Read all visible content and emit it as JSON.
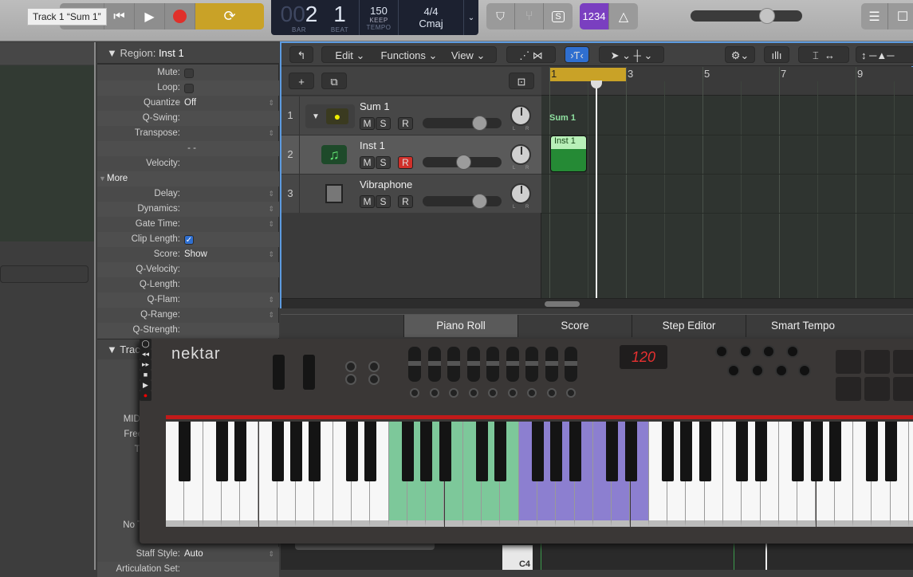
{
  "tooltip": "Track 1 “Sum 1”",
  "transport": {
    "buttons": [
      "forward-icon",
      "go-to-start-icon",
      "play-icon",
      "record-icon",
      "cycle-icon"
    ],
    "cycle_color": "#c9a227",
    "record_color": "#e0302a"
  },
  "lcd": {
    "bar_prefix": "00",
    "bar": "2",
    "beat": "1",
    "bar_label": "BAR",
    "beat_label": "BEAT",
    "tempo": "150",
    "tempo_mode": "KEEP",
    "tempo_label": "TEMPO",
    "signature": "4/4",
    "key": "Cmaj"
  },
  "toolbar_right": {
    "count_in": "1234",
    "count_in_color": "#7a3fc0",
    "master_volume": 0.68
  },
  "inspector": {
    "region_header": "Region:",
    "region_name": "Inst 1",
    "rows": [
      {
        "label": "Mute:",
        "type": "check",
        "checked": false
      },
      {
        "label": "Loop:",
        "type": "check",
        "checked": false
      },
      {
        "label": "Quantize",
        "value": "Off",
        "stepper": true
      },
      {
        "label": "Q-Swing:"
      },
      {
        "label": "Transpose:",
        "stepper": true
      },
      {
        "label": "- -"
      },
      {
        "label": "Velocity:"
      },
      {
        "label": "More",
        "section": true
      },
      {
        "label": "Delay:",
        "stepper": true
      },
      {
        "label": "Dynamics:",
        "stepper": true
      },
      {
        "label": "Gate Time:",
        "stepper": true
      },
      {
        "label": "Clip Length:",
        "type": "check",
        "checked": true
      },
      {
        "label": "Score:",
        "value": "Show",
        "stepper": true
      },
      {
        "label": "Q-Velocity:"
      },
      {
        "label": "Q-Length:"
      },
      {
        "label": "Q-Flam:",
        "stepper": true
      },
      {
        "label": "Q-Range:",
        "stepper": true
      },
      {
        "label": "Q-Strength:"
      }
    ],
    "track_header": "Track",
    "track_fragments": [
      "MIDI",
      "Free",
      "Tr",
      "No T"
    ],
    "staff_style_label": "Staff Style:",
    "staff_style_value": "Auto",
    "articulation_label": "Articulation Set:"
  },
  "tracks_toolbar": {
    "edit": "Edit",
    "functions": "Functions",
    "view": "View"
  },
  "tracks": [
    {
      "num": "1",
      "name": "Sum 1",
      "icon": "summing-stack-icon",
      "record_armed": false,
      "volume": 0.72,
      "pan": 0
    },
    {
      "num": "2",
      "name": "Inst 1",
      "icon": "music-note-icon",
      "record_armed": true,
      "volume": 0.52,
      "pan": 0,
      "selected": true
    },
    {
      "num": "3",
      "name": "Vibraphone",
      "icon": "vibraphone-icon",
      "record_armed": false,
      "volume": 0.72,
      "pan": 0
    }
  ],
  "track_buttons": {
    "mute": "M",
    "solo": "S",
    "record": "R",
    "pan_l": "L",
    "pan_r": "R"
  },
  "ruler": {
    "bars": [
      "1",
      "3",
      "5",
      "7",
      "9"
    ],
    "cycle": [
      1,
      3
    ],
    "playhead_bar": 2.2
  },
  "regions": {
    "summary": "Sum 1",
    "inst": "Inst 1"
  },
  "editor_tabs": [
    "Piano Roll",
    "Score",
    "Step Editor",
    "Smart Tempo"
  ],
  "active_tab": "Piano Roll",
  "controller": {
    "brand": "nektar",
    "display": "120",
    "green": "#7dc89a",
    "purple": "#8c7fd0",
    "green_keys": [
      12,
      18
    ],
    "purple_keys": [
      19,
      25
    ]
  },
  "piano_roll": {
    "note_label": "C4"
  }
}
